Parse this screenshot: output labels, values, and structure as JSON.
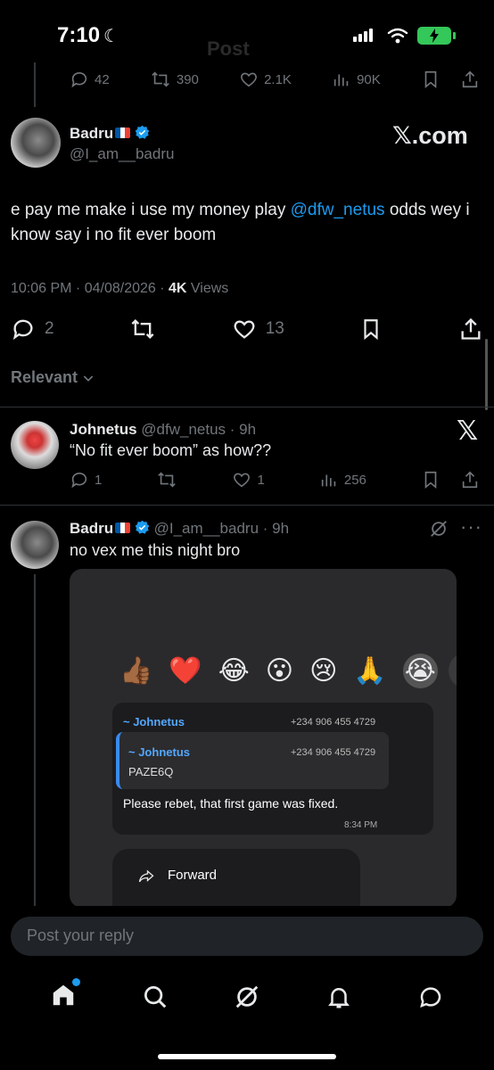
{
  "status_bar": {
    "time": "7:10"
  },
  "header_ghost_title": "Post",
  "prev_actions": {
    "replies": "42",
    "reposts": "390",
    "likes": "2.1K",
    "views": "90K"
  },
  "main_post": {
    "author_name": "Badru",
    "handle": "@I_am__badru",
    "watermark": "𝕏.com",
    "text_before": "e pay me make i use my money play ",
    "mention": "@dfw_netus",
    "text_after": " odds wey i know say i no fit ever boom",
    "time": "10:06 PM",
    "date": "04/08/2026",
    "views_count": "4K",
    "views_label": "Views",
    "replies": "2",
    "likes": "13"
  },
  "sort_label": "Relevant",
  "reply1": {
    "author_name": "Johnetus",
    "handle": "@dfw_netus",
    "age": "9h",
    "text": "“No fit ever boom” as how??",
    "replies": "1",
    "likes": "1",
    "views": "256"
  },
  "reply2": {
    "author_name": "Badru",
    "handle": "@I_am__badru",
    "age": "9h",
    "text": "no vex me this night bro"
  },
  "attached_image": {
    "emojis": [
      "👍🏾",
      "❤️",
      "😂",
      "😮",
      "😢",
      "🙏",
      "😭"
    ],
    "sender": "~ Johnetus",
    "phone": "+234 906 455 4729",
    "quoted_sender": "~ Johnetus",
    "quoted_phone": "+234 906 455 4729",
    "quoted_text": "PAZE6Q",
    "message": "Please rebet, that first game was fixed.",
    "msg_time": "8:34 PM",
    "menu_forward": "Forward"
  },
  "reply_input": {
    "placeholder": "Post your reply"
  },
  "colors": {
    "accent": "#1d9bf0",
    "background": "#000000",
    "muted": "#71767b"
  },
  "icons": [
    "reply-icon",
    "repost-icon",
    "like-icon",
    "views-icon",
    "bookmark-icon",
    "share-icon",
    "verified-icon",
    "grok-icon",
    "more-icon",
    "home-icon",
    "search-icon",
    "notifications-icon",
    "messages-icon"
  ]
}
